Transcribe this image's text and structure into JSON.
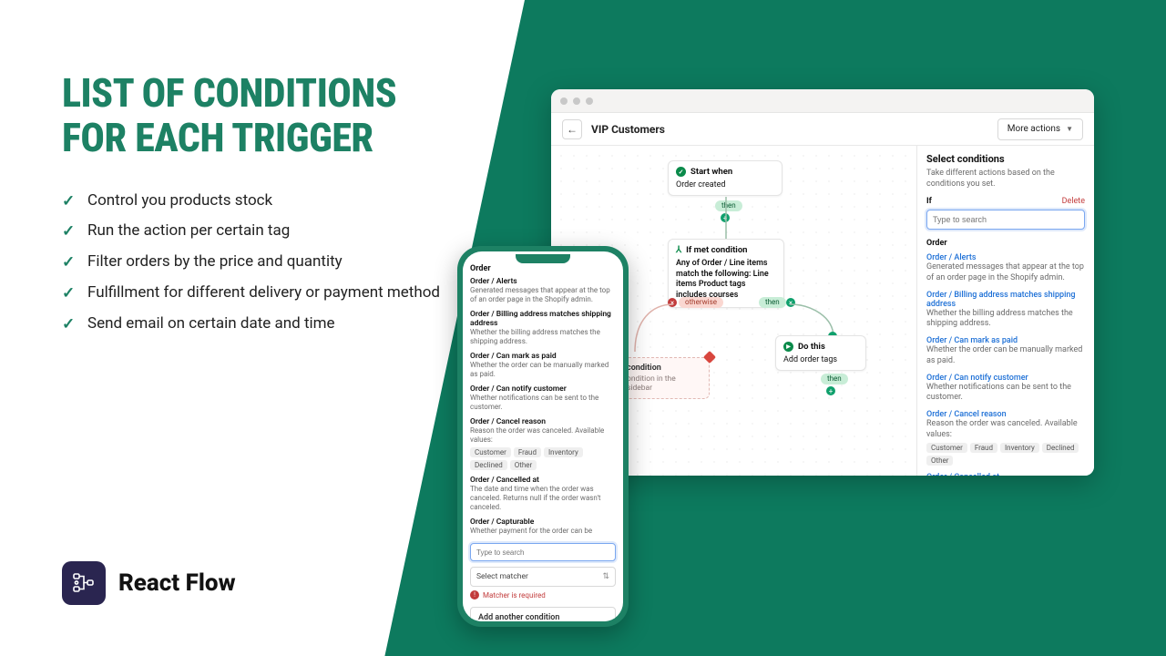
{
  "headline": "LIST OF CONDITIONS FOR EACH TRIGGER",
  "bullets": [
    "Control you products stock",
    "Run the action per certain tag",
    "Filter orders by the price and quantity",
    "Fulfillment for different delivery or payment method",
    "Send email on certain date and time"
  ],
  "brand": {
    "name": "React Flow"
  },
  "colors": {
    "accent": "#1d8164"
  },
  "desktop": {
    "title": "VIP Customers",
    "more_actions": "More actions",
    "flow": {
      "start": {
        "label": "Start when",
        "body": "Order created"
      },
      "condition_full": {
        "label": "If met condition",
        "body": "Any of Order / Line items match the following: Line items Product tags includes courses"
      },
      "condition_empty": {
        "label": "condition",
        "sub": "ondition in the sidebar"
      },
      "do_this": {
        "label": "Do this",
        "body": "Add order tags"
      },
      "pills": {
        "then": "then",
        "otherwise": "otherwise"
      }
    },
    "sidepanel": {
      "title": "Select conditions",
      "sub": "Take different actions based on the conditions you set.",
      "if_label": "If",
      "delete": "Delete",
      "search_placeholder": "Type to search",
      "group": "Order",
      "items": [
        {
          "title": "Order / Alerts",
          "desc": "Generated messages that appear at the top of an order page in the Shopify admin."
        },
        {
          "title": "Order / Billing address matches shipping address",
          "desc": "Whether the billing address matches the shipping address."
        },
        {
          "title": "Order / Can mark as paid",
          "desc": "Whether the order can be manually marked as paid."
        },
        {
          "title": "Order / Can notify customer",
          "desc": "Whether notifications can be sent to the customer."
        },
        {
          "title": "Order / Cancel reason",
          "desc": "Reason the order was canceled. Available values:",
          "tags": [
            "Customer",
            "Fraud",
            "Inventory",
            "Declined",
            "Other"
          ]
        },
        {
          "title": "Order / Cancelled at",
          "desc": ""
        }
      ]
    }
  },
  "mobile": {
    "group": "Order",
    "search_placeholder": "Type to search",
    "select_matcher": "Select matcher",
    "error": "Matcher is required",
    "add_another": "Add another condition",
    "items": [
      {
        "title": "Order / Alerts",
        "desc": "Generated messages that appear at the top of an order page in the Shopify admin."
      },
      {
        "title": "Order / Billing address matches shipping address",
        "desc": "Whether the billing address matches the shipping address."
      },
      {
        "title": "Order / Can mark as paid",
        "desc": "Whether the order can be manually marked as paid."
      },
      {
        "title": "Order / Can notify customer",
        "desc": "Whether notifications can be sent to the customer."
      },
      {
        "title": "Order / Cancel reason",
        "desc": "Reason the order was canceled. Available values:",
        "tags": [
          "Customer",
          "Fraud",
          "Inventory",
          "Declined",
          "Other"
        ]
      },
      {
        "title": "Order / Cancelled at",
        "desc": "The date and time when the order was canceled. Returns null if the order wasn't canceled."
      },
      {
        "title": "Order / Capturable",
        "desc": "Whether payment for the order can be"
      }
    ]
  }
}
